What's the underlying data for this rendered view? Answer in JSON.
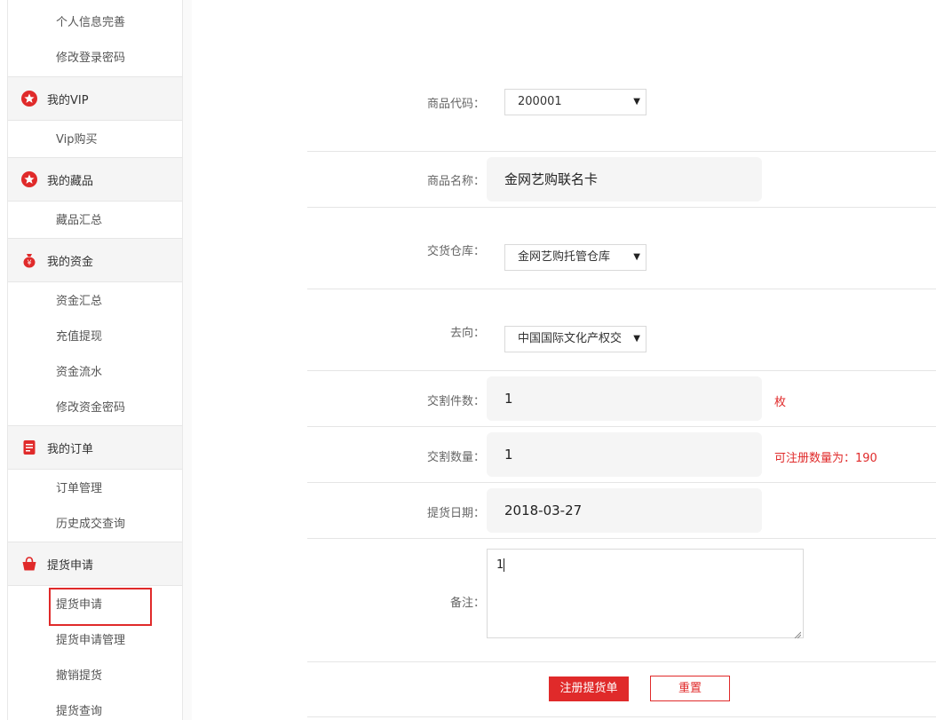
{
  "sidebar": {
    "sub_personal_info": "个人信息完善",
    "sub_change_login_pwd": "修改登录密码",
    "head_vip": "我的VIP",
    "sub_vip_buy": "Vip购买",
    "head_collection": "我的藏品",
    "sub_collection_summary": "藏品汇总",
    "head_funds": "我的资金",
    "sub_funds_summary": "资金汇总",
    "sub_recharge_withdraw": "充值提现",
    "sub_funds_flow": "资金流水",
    "sub_change_funds_pwd": "修改资金密码",
    "head_orders": "我的订单",
    "sub_order_manage": "订单管理",
    "sub_history_trades": "历史成交查询",
    "head_pickup": "提货申请",
    "sub_pickup_apply": "提货申请",
    "sub_pickup_manage": "提货申请管理",
    "sub_pickup_cancel": "撤销提货",
    "sub_pickup_query": "提货查询"
  },
  "form": {
    "code_label": "商品代码：",
    "code_value": "200001",
    "name_label": "商品名称：",
    "name_value": "金网艺购联名卡",
    "warehouse_label": "交货仓库：",
    "warehouse_value": "金网艺购托管仓库",
    "direction_label": "去向：",
    "direction_value": "中国国际文化产权交",
    "pieces_label": "交割件数：",
    "pieces_value": "1",
    "pieces_unit": "枚",
    "qty_label": "交割数量：",
    "qty_value": "1",
    "qty_hint": "可注册数量为：190",
    "date_label": "提货日期：",
    "date_value": "2018-03-27",
    "remark_label": "备注：",
    "remark_value": "1",
    "submit_label": "注册提货单",
    "reset_label": "重置"
  },
  "colors": {
    "accent": "#e02a2a"
  }
}
